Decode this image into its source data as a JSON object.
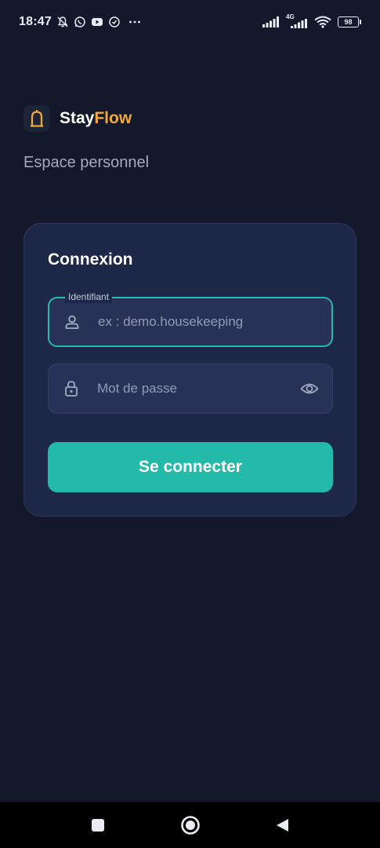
{
  "status_bar": {
    "time": "18:47",
    "network": "4G",
    "battery": "98",
    "left_icons": [
      "bell-off-icon",
      "whatsapp-icon",
      "youtube-icon",
      "sync-icon",
      "more-icon"
    ],
    "right_icons": [
      "signal-icon",
      "signal-4g-icon",
      "wifi-icon",
      "battery-icon"
    ]
  },
  "brand": {
    "name_part1": "Stay",
    "name_part2": "Flow",
    "logo_icon": "bell-tower-icon",
    "accent_color": "#f2a93b"
  },
  "subtitle": "Espace personnel",
  "login_card": {
    "title": "Connexion",
    "username": {
      "label": "Identifiant",
      "placeholder": "ex : demo.housekeeping",
      "value": "",
      "icon": "user-icon"
    },
    "password": {
      "placeholder": "Mot de passe",
      "value": "",
      "icon": "lock-icon",
      "toggle_icon": "eye-icon"
    },
    "submit_label": "Se connecter",
    "accent_color": "#24baa9"
  },
  "nav_bar": {
    "buttons": [
      "square-icon",
      "home-circle-icon",
      "back-triangle-icon"
    ]
  }
}
